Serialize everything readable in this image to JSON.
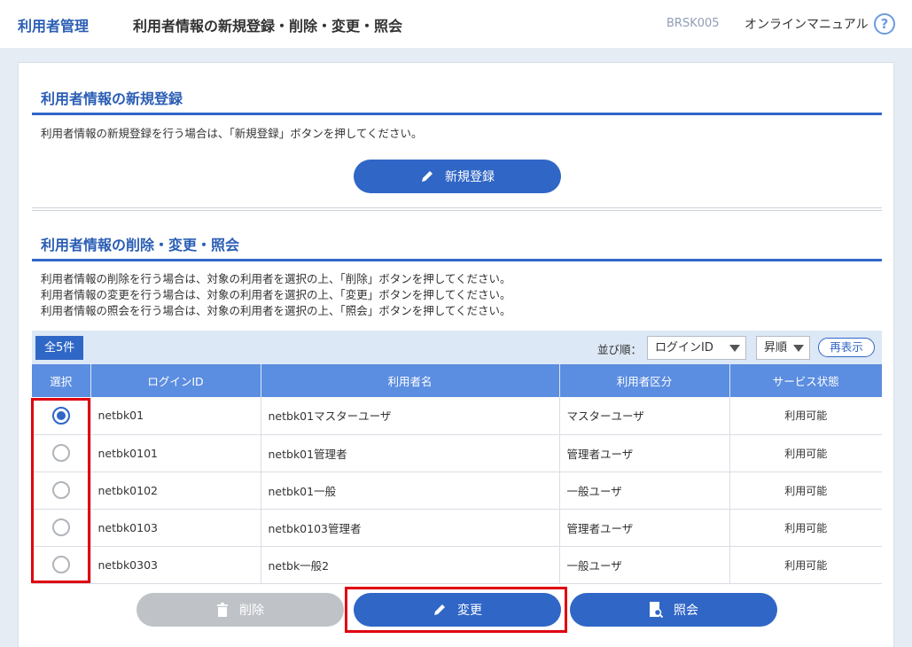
{
  "header": {
    "section": "利用者管理",
    "title": "利用者情報の新規登録・削除・変更・照会",
    "screen_id": "BRSK005",
    "manual_link": "オンラインマニュアル",
    "help_icon": "?"
  },
  "register_section": {
    "title": "利用者情報の新規登録",
    "description": "利用者情報の新規登録を行う場合は、「新規登録」ボタンを押してください。",
    "button_label": "新規登録"
  },
  "manage_section": {
    "title": "利用者情報の削除・変更・照会",
    "descriptions": [
      "利用者情報の削除を行う場合は、対象の利用者を選択の上、「削除」ボタンを押してください。",
      "利用者情報の変更を行う場合は、対象の利用者を選択の上、「変更」ボタンを押してください。",
      "利用者情報の照会を行う場合は、対象の利用者を選択の上、「照会」ボタンを押してください。"
    ]
  },
  "toolbar": {
    "count": "全5件",
    "sort_label": "並び順：",
    "sort_field": "ログインID",
    "sort_order": "昇順",
    "refresh": "再表示"
  },
  "table": {
    "headers": [
      "選択",
      "ログインID",
      "利用者名",
      "利用者区分",
      "サービス状態"
    ],
    "rows": [
      {
        "selected": true,
        "login_id": "netbk01",
        "name": "netbk01マスターユーザ",
        "type": "マスターユーザ",
        "status": "利用可能"
      },
      {
        "selected": false,
        "login_id": "netbk0101",
        "name": "netbk01管理者",
        "type": "管理者ユーザ",
        "status": "利用可能"
      },
      {
        "selected": false,
        "login_id": "netbk0102",
        "name": "netbk01一般",
        "type": "一般ユーザ",
        "status": "利用可能"
      },
      {
        "selected": false,
        "login_id": "netbk0103",
        "name": "netbk0103管理者",
        "type": "管理者ユーザ",
        "status": "利用可能"
      },
      {
        "selected": false,
        "login_id": "netbk0303",
        "name": "netbk一般2",
        "type": "一般ユーザ",
        "status": "利用可能"
      }
    ]
  },
  "actions": {
    "delete": "削除",
    "change": "変更",
    "inquiry": "照会"
  },
  "colors": {
    "primary": "#3066c6",
    "header_blue": "#5b8de0",
    "highlight_red": "#e00010",
    "disabled": "#bfc3c8"
  }
}
